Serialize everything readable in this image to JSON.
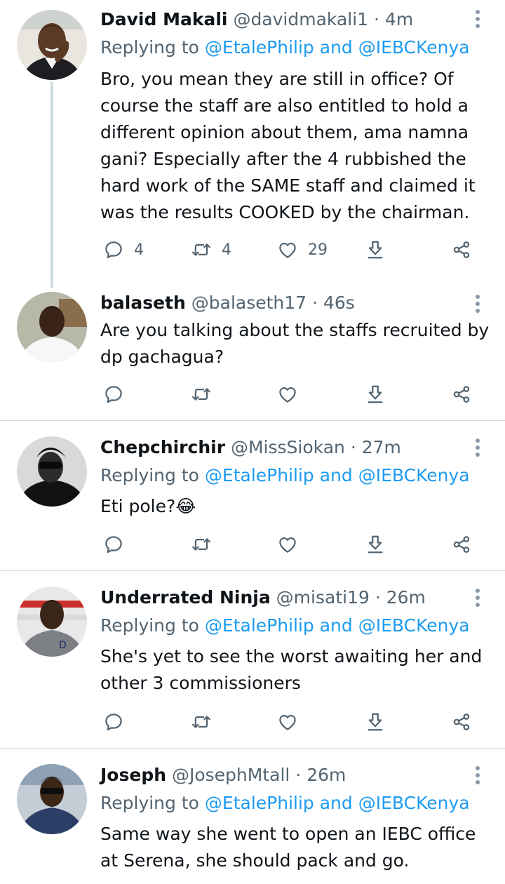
{
  "tweets": [
    {
      "name": "David Makali",
      "handle": "@davidmakali1",
      "time": "· 4m",
      "replying_prefix": "Replying to",
      "mention1": "@EtalePhilip",
      "and_text": "and",
      "mention2": "@IEBCKenya",
      "text": "Bro, you mean they are still in office? Of course the staff are also entitled to hold a different opinion about them, ama namna gani? Especially after the 4 rubbished the hard work of the SAME staff and claimed it was the results COOKED by the chairman.",
      "replies": "4",
      "retweets": "4",
      "likes": "29"
    },
    {
      "name": "balaseth",
      "handle": "@balaseth17",
      "time": "· 46s",
      "text": "Are you talking about the staffs recruited by dp gachagua?"
    },
    {
      "name": "Chepchirchir",
      "handle": "@MissSiokan",
      "time": "· 27m",
      "replying_prefix": "Replying to",
      "mention1": "@EtalePhilip",
      "and_text": "and",
      "mention2": "@IEBCKenya",
      "text": "Eti pole?😂"
    },
    {
      "name": "Underrated Ninja",
      "handle": "@misati19",
      "time": "· 26m",
      "replying_prefix": "Replying to",
      "mention1": "@EtalePhilip",
      "and_text": "and",
      "mention2": "@IEBCKenya",
      "text": "She's yet to see the worst awaiting her and other 3 commissioners"
    },
    {
      "name": "Joseph",
      "handle": "@JosephMtall",
      "time": "· 26m",
      "replying_prefix": "Replying to",
      "mention1": "@EtalePhilip",
      "and_text": "and",
      "mention2": "@IEBCKenya",
      "text": "Same way she went to open an IEBC office at Serena, she should pack and go."
    }
  ],
  "icons": {
    "reply": "reply-icon",
    "retweet": "retweet-icon",
    "like": "heart-icon",
    "bookmark": "bookmark-icon",
    "share": "share-icon",
    "more": "more-options-icon"
  },
  "colors": {
    "accent": "#1d9bf0",
    "text": "#0f1419",
    "secondary": "#536471",
    "divider": "#cfd9de"
  }
}
